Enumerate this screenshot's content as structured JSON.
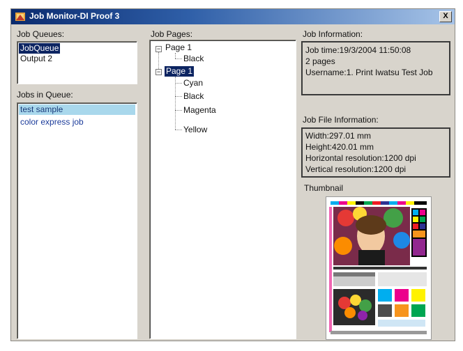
{
  "window": {
    "title": "Job Monitor-DI Proof 3",
    "close_label": "X"
  },
  "job_queues": {
    "label": "Job Queues:",
    "items": [
      "JobQueue",
      "Output 2"
    ]
  },
  "jobs_in_queue": {
    "label": "Jobs in Queue:",
    "items": [
      "test sample",
      "color express job"
    ]
  },
  "job_pages": {
    "label": "Job Pages:",
    "pages": [
      {
        "label": "Page 1",
        "expander": "−",
        "plates": [
          "Black"
        ]
      },
      {
        "label": "Page 1",
        "expander": "−",
        "plates": [
          "Cyan",
          "Black",
          "Magenta",
          "Yellow"
        ]
      }
    ]
  },
  "job_information": {
    "label": "Job Information:",
    "lines": [
      "Job time:19/3/2004 11:50:08",
      "2 pages",
      "Username:1. Print Iwatsu Test Job"
    ]
  },
  "job_file_information": {
    "label": "Job File Information:",
    "lines": [
      "Width:297.01 mm",
      "Height:420.01 mm",
      "Horizontal resolution:1200 dpi",
      "Vertical resolution:1200 dpi"
    ]
  },
  "thumbnail": {
    "label": "Thumbnail"
  },
  "colors": {
    "title_dark": "#0a2a6e",
    "title_light": "#a7c4e8",
    "selection_dark": "#0c2461",
    "selection_light": "#a9d8ec",
    "window_bg": "#d8d4cc"
  }
}
